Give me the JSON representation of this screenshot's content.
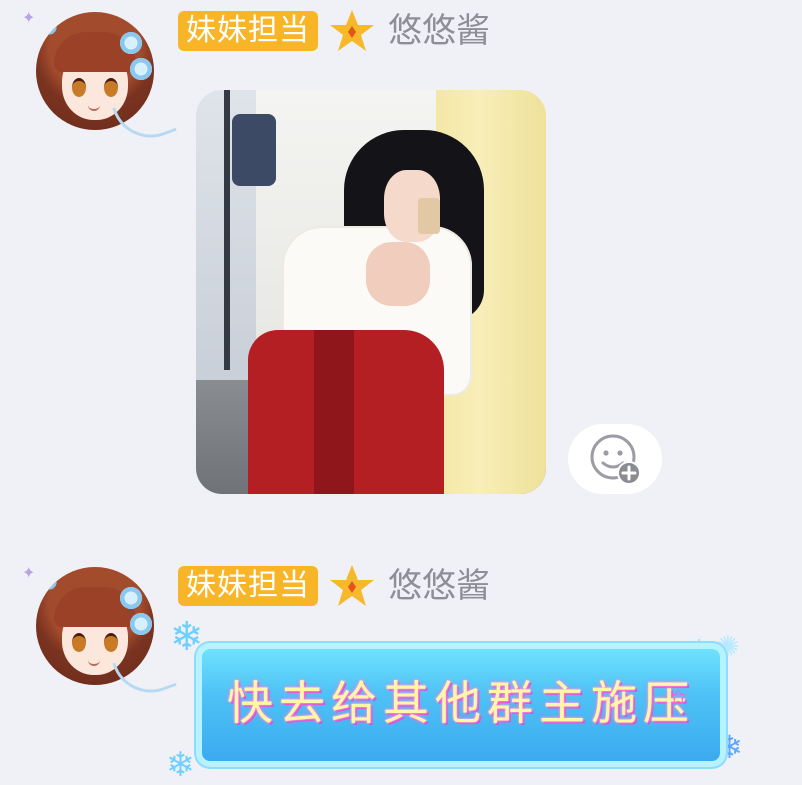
{
  "messages": [
    {
      "sender": {
        "title_badge": "妹妹担当",
        "level_icon": "star-icon",
        "nickname": "悠悠酱",
        "avatar_icon": "anime-girl-avatar"
      },
      "content_type": "image",
      "reaction_icon": "add-emoji-icon"
    },
    {
      "sender": {
        "title_badge": "妹妹担当",
        "level_icon": "star-icon",
        "nickname": "悠悠酱",
        "avatar_icon": "anime-girl-avatar"
      },
      "content_type": "sticker",
      "sticker_text": "快去给其他群主施压"
    }
  ],
  "colors": {
    "background": "#f0f1f6",
    "badge": "#f8b528",
    "nickname": "#8e8e96",
    "star": "#f7b82a"
  }
}
